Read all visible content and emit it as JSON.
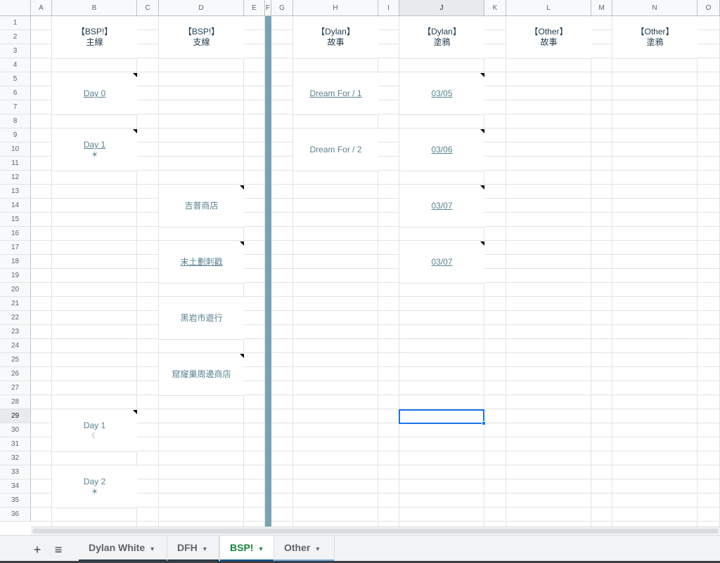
{
  "columns": [
    "A",
    "B",
    "C",
    "D",
    "E",
    "F",
    "G",
    "H",
    "I",
    "J",
    "K",
    "L",
    "M",
    "N",
    "O"
  ],
  "rows": [
    "1",
    "2",
    "3",
    "4",
    "5",
    "6",
    "7",
    "8",
    "9",
    "10",
    "11",
    "12",
    "13",
    "14",
    "15",
    "16",
    "17",
    "18",
    "19",
    "20",
    "21",
    "22",
    "23",
    "24",
    "25",
    "26",
    "27",
    "28",
    "29",
    "30",
    "31",
    "32",
    "33",
    "34",
    "35",
    "36"
  ],
  "selected_cell": {
    "column": "J",
    "row": "29"
  },
  "headers": {
    "b": {
      "line1": "【BSP!】",
      "line2": "主線"
    },
    "d": {
      "line1": "【BSP!】",
      "line2": "支線"
    },
    "h": {
      "line1": "【Dylan】",
      "line2": "故事"
    },
    "j": {
      "line1": "【Dylan】",
      "line2": "塗鴉"
    },
    "l": {
      "line1": "【Other】",
      "line2": "故事"
    },
    "n": {
      "line1": "【Other】",
      "line2": "塗鴉"
    }
  },
  "col_b": [
    {
      "text": "Day 0",
      "sub": "",
      "link": true
    },
    {
      "text": "Day 1",
      "sub": "☀",
      "link": true
    },
    {
      "text": "Day 1",
      "sub": "☾",
      "link": false
    },
    {
      "text": "Day 2",
      "sub": "☀",
      "link": false
    }
  ],
  "col_d": [
    {
      "text": "吉普商店",
      "link": false
    },
    {
      "text": "末土劃刺戳",
      "link": true
    },
    {
      "text": "黑岩市遊行",
      "link": false
    },
    {
      "text": "窟窿巢周邊商店",
      "link": false
    }
  ],
  "col_h": [
    {
      "text": "Dream For / 1",
      "link": true
    },
    {
      "text": "Dream For / 2",
      "link": false
    }
  ],
  "col_j": [
    {
      "text": "03/05",
      "link": true
    },
    {
      "text": "03/06",
      "link": true
    },
    {
      "text": "03/07",
      "link": true
    },
    {
      "text": "03/07",
      "link": true
    }
  ],
  "tabbar": {
    "add_label": "+",
    "menu_label": "≡",
    "tabs": [
      {
        "label": "Dylan White",
        "stripe": "#1f3a4d",
        "active": false
      },
      {
        "label": "DFH",
        "stripe": "#1f3a4d",
        "active": false
      },
      {
        "label": "BSP!",
        "stripe": "#0b5394",
        "active": true
      },
      {
        "label": "Other",
        "stripe": "#6fa8dc",
        "active": false
      }
    ],
    "caret": "▾"
  },
  "colors": {
    "header_text": "#1f3a4d",
    "teal_text": "#5a8291",
    "frozen_bar": "#7aa2b0",
    "selection": "#1a73e8",
    "active_tab_text": "#188038"
  }
}
